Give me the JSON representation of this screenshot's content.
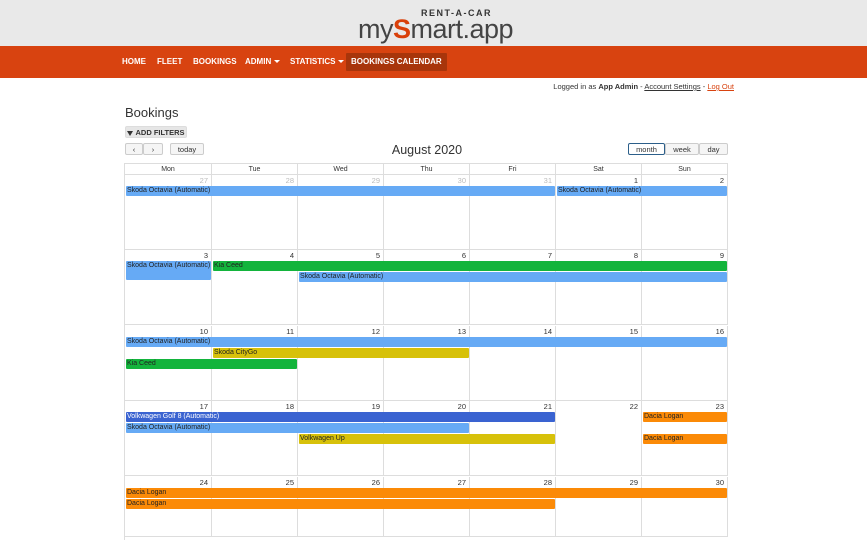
{
  "header": {
    "logo_top": "RENT-A-CAR",
    "logo_my": "my",
    "logo_s": "S",
    "logo_rest": "mart.app"
  },
  "nav": [
    {
      "label": "HOME",
      "dropdown": false,
      "active": false
    },
    {
      "label": "FLEET",
      "dropdown": false,
      "active": false
    },
    {
      "label": "BOOKINGS",
      "dropdown": false,
      "active": false
    },
    {
      "label": "ADMIN",
      "dropdown": true,
      "active": false
    },
    {
      "label": "STATISTICS",
      "dropdown": true,
      "active": false
    },
    {
      "label": "BOOKINGS CALENDAR",
      "dropdown": false,
      "active": true
    }
  ],
  "user": {
    "prefix": "Logged in as",
    "name": "App Admin",
    "sep1": "-",
    "account": "Account Settings",
    "sep2": "-",
    "logout": "Log Out"
  },
  "page": {
    "title": "Bookings",
    "filters_button": "ADD FILTERS"
  },
  "calendar": {
    "title": "August 2020",
    "prev": "‹",
    "next": "›",
    "today": "today",
    "views": [
      "month",
      "week",
      "day"
    ],
    "active_view": "month",
    "weekdays": [
      "Mon",
      "Tue",
      "Wed",
      "Thu",
      "Fri",
      "Sat",
      "Sun"
    ],
    "weeks": [
      [
        {
          "d": "27",
          "other": true
        },
        {
          "d": "28",
          "other": true
        },
        {
          "d": "29",
          "other": true
        },
        {
          "d": "30",
          "other": true
        },
        {
          "d": "31",
          "other": true
        },
        {
          "d": "1",
          "other": false
        },
        {
          "d": "2",
          "other": false
        }
      ],
      [
        {
          "d": "3",
          "other": false
        },
        {
          "d": "4",
          "other": false
        },
        {
          "d": "5",
          "other": false
        },
        {
          "d": "6",
          "other": false
        },
        {
          "d": "7",
          "other": false
        },
        {
          "d": "8",
          "other": false
        },
        {
          "d": "9",
          "other": false
        }
      ],
      [
        {
          "d": "10",
          "other": false
        },
        {
          "d": "11",
          "other": false
        },
        {
          "d": "12",
          "other": false
        },
        {
          "d": "13",
          "other": false
        },
        {
          "d": "14",
          "other": false
        },
        {
          "d": "15",
          "other": false
        },
        {
          "d": "16",
          "other": false
        }
      ],
      [
        {
          "d": "17",
          "other": false
        },
        {
          "d": "18",
          "other": false
        },
        {
          "d": "19",
          "other": false
        },
        {
          "d": "20",
          "other": false
        },
        {
          "d": "21",
          "other": false
        },
        {
          "d": "22",
          "other": false
        },
        {
          "d": "23",
          "other": false
        }
      ],
      [
        {
          "d": "24",
          "other": false
        },
        {
          "d": "25",
          "other": false
        },
        {
          "d": "26",
          "other": false
        },
        {
          "d": "27",
          "other": false
        },
        {
          "d": "28",
          "other": false
        },
        {
          "d": "29",
          "other": false
        },
        {
          "d": "30",
          "other": false
        }
      ]
    ],
    "colors": {
      "light_blue": "#66aaf5",
      "green": "#13b43c",
      "yellow": "#d7c10a",
      "dark_blue": "#3a63d1",
      "orange": "#fb8a07"
    },
    "events": [
      {
        "title": "Skoda Octavia (Automatic)",
        "week": 0,
        "start": 0,
        "end": 4,
        "row": 0,
        "color": "light_blue"
      },
      {
        "title": "Skoda Octavia (Automatic)",
        "week": 0,
        "start": 5,
        "end": 6,
        "row": 0,
        "color": "light_blue"
      },
      {
        "title": "Skoda Octavia (Automatic)",
        "week": 1,
        "start": 0,
        "end": 0,
        "row": 0,
        "color": "light_blue",
        "wrap": true
      },
      {
        "title": "Kia Ceed",
        "week": 1,
        "start": 1,
        "end": 6,
        "row": 0,
        "color": "green"
      },
      {
        "title": "Skoda Octavia (Automatic)",
        "week": 1,
        "start": 2,
        "end": 6,
        "row": 1,
        "color": "light_blue"
      },
      {
        "title": "Skoda Octavia (Automatic)",
        "week": 2,
        "start": 0,
        "end": 6,
        "row": 0,
        "color": "light_blue"
      },
      {
        "title": "Skoda CityGo",
        "week": 2,
        "start": 1,
        "end": 3,
        "row": 1,
        "color": "yellow"
      },
      {
        "title": "Kia Ceed",
        "week": 2,
        "start": 0,
        "end": 1,
        "row": 2,
        "color": "green"
      },
      {
        "title": "Volkwagen Golf 8 (Automatic)",
        "week": 3,
        "start": 0,
        "end": 4,
        "row": 0,
        "color": "dark_blue"
      },
      {
        "title": "Dacia Logan",
        "week": 3,
        "start": 6,
        "end": 6,
        "row": 0,
        "color": "orange"
      },
      {
        "title": "Skoda Octavia (Automatic)",
        "week": 3,
        "start": 0,
        "end": 3,
        "row": 1,
        "color": "light_blue"
      },
      {
        "title": "Volkwagen Up",
        "week": 3,
        "start": 2,
        "end": 4,
        "row": 2,
        "color": "yellow"
      },
      {
        "title": "Dacia Logan",
        "week": 3,
        "start": 6,
        "end": 6,
        "row": 2,
        "color": "orange"
      },
      {
        "title": "Dacia Logan",
        "week": 4,
        "start": 0,
        "end": 6,
        "row": 0,
        "color": "orange"
      },
      {
        "title": "Dacia Logan",
        "week": 4,
        "start": 0,
        "end": 4,
        "row": 1,
        "color": "orange"
      }
    ]
  }
}
